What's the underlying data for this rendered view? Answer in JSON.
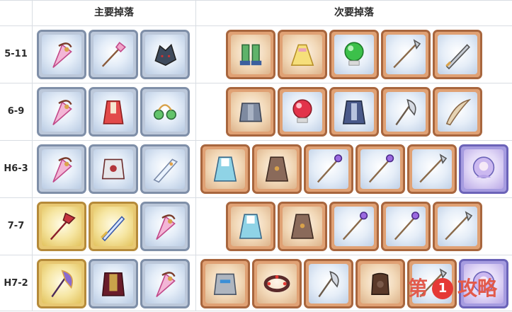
{
  "headers": {
    "main": "主要掉落",
    "secondary": "次要掉落"
  },
  "rows": [
    {
      "stage": "5-11",
      "main": [
        {
          "icon": "pink-crystal-pendant",
          "frame": "silver"
        },
        {
          "icon": "pink-crystal-wand",
          "frame": "silver"
        },
        {
          "icon": "dark-wolf-helm",
          "frame": "silver"
        }
      ],
      "secondary": [
        {
          "icon": "green-boots",
          "frame": "copper"
        },
        {
          "icon": "yellow-dress",
          "frame": "copper"
        },
        {
          "icon": "green-orb",
          "frame": "copper-silver"
        },
        {
          "icon": "silver-spear",
          "frame": "copper-silver"
        },
        {
          "icon": "silver-sword",
          "frame": "copper-silver"
        }
      ]
    },
    {
      "stage": "6-9",
      "main": [
        {
          "icon": "pink-crystal-pendant",
          "frame": "silver"
        },
        {
          "icon": "red-robe",
          "frame": "silver"
        },
        {
          "icon": "green-earrings",
          "frame": "silver"
        }
      ],
      "secondary": [
        {
          "icon": "steel-armor",
          "frame": "copper"
        },
        {
          "icon": "red-orb",
          "frame": "copper-silver"
        },
        {
          "icon": "blue-cloak-armor",
          "frame": "copper-silver"
        },
        {
          "icon": "battle-axe",
          "frame": "copper-silver"
        },
        {
          "icon": "curved-blade",
          "frame": "copper-silver"
        }
      ]
    },
    {
      "stage": "H6-3",
      "main": [
        {
          "icon": "pink-crystal-pendant",
          "frame": "silver"
        },
        {
          "icon": "plate-armor",
          "frame": "silver"
        },
        {
          "icon": "crystal-blade",
          "frame": "silver"
        }
      ],
      "secondary": [
        {
          "icon": "blue-cape-robe",
          "frame": "copper"
        },
        {
          "icon": "brown-robe",
          "frame": "copper"
        },
        {
          "icon": "purple-magic-staff",
          "frame": "copper-silver"
        },
        {
          "icon": "purple-magic-staff",
          "frame": "copper-silver"
        },
        {
          "icon": "silver-spear",
          "frame": "copper-silver"
        },
        {
          "icon": "character-memory-piece",
          "frame": "purple"
        }
      ]
    },
    {
      "stage": "7-7",
      "main": [
        {
          "icon": "crimson-scepter",
          "frame": "gold"
        },
        {
          "icon": "ornate-sword",
          "frame": "gold"
        },
        {
          "icon": "pink-crystal-pendant",
          "frame": "silver"
        }
      ],
      "secondary": [
        {
          "icon": "blue-cape-robe",
          "frame": "copper"
        },
        {
          "icon": "brown-robe",
          "frame": "copper"
        },
        {
          "icon": "purple-magic-staff",
          "frame": "copper-silver"
        },
        {
          "icon": "purple-magic-staff",
          "frame": "copper-silver"
        },
        {
          "icon": "silver-spear",
          "frame": "copper-silver"
        }
      ]
    },
    {
      "stage": "H7-2",
      "main": [
        {
          "icon": "purple-gold-axe",
          "frame": "gold"
        },
        {
          "icon": "crimson-royal-armor",
          "frame": "silver"
        },
        {
          "icon": "pink-crystal-pendant",
          "frame": "silver"
        }
      ],
      "secondary": [
        {
          "icon": "steel-gauntlet-armor",
          "frame": "copper"
        },
        {
          "icon": "studded-bracelet",
          "frame": "copper"
        },
        {
          "icon": "battle-axe",
          "frame": "copper-silver"
        },
        {
          "icon": "leather-glove",
          "frame": "copper"
        },
        {
          "icon": "silver-spear",
          "frame": "copper-silver"
        },
        {
          "icon": "character-memory-piece",
          "frame": "purple"
        }
      ]
    }
  ],
  "watermark": {
    "left": "第",
    "badge": "1",
    "right": "攻略"
  }
}
